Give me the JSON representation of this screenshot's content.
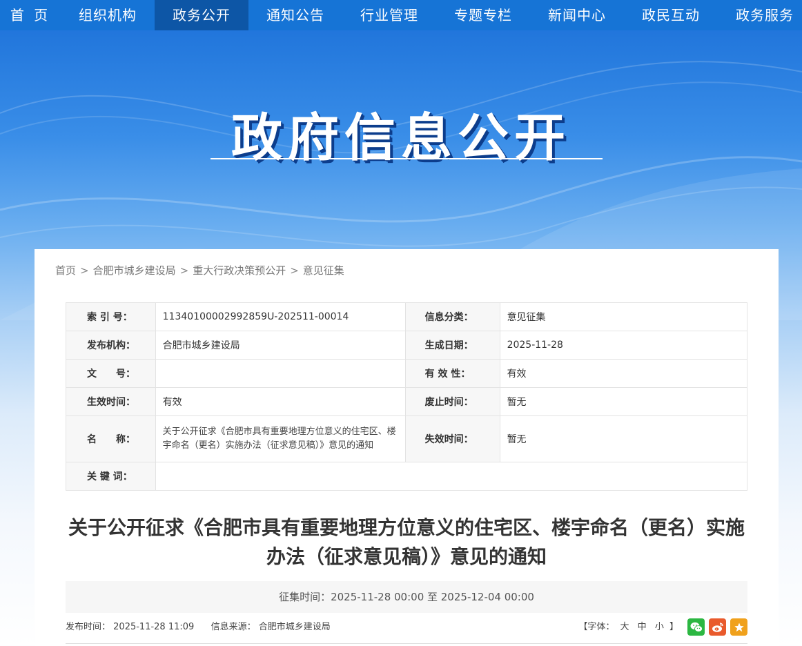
{
  "nav": {
    "items": [
      {
        "label": "首 页"
      },
      {
        "label": "组织机构"
      },
      {
        "label": "政务公开"
      },
      {
        "label": "通知公告"
      },
      {
        "label": "行业管理"
      },
      {
        "label": "专题专栏"
      },
      {
        "label": "新闻中心"
      },
      {
        "label": "政民互动"
      },
      {
        "label": "政务服务"
      }
    ],
    "active_index": 2,
    "color": "#1674d6",
    "active_color": "#0d56a6"
  },
  "banner": {
    "title": "政府信息公开"
  },
  "breadcrumb": {
    "items": [
      "首页",
      "合肥市城乡建设局",
      "重大行政决策预公开",
      "意见征集"
    ],
    "separator": ">"
  },
  "meta": {
    "index_no_label": "索 引 号：",
    "index_no": "11340100002992859U-202511-00014",
    "category_label": "信息分类：",
    "category": "意见征集",
    "publisher_label": "发布机构：",
    "publisher": "合肥市城乡建设局",
    "created_label": "生成日期：",
    "created": "2025-11-28",
    "doc_no_label": "文　　号：",
    "doc_no": "",
    "validity_label": "有 效 性：",
    "validity": "有效",
    "effective_label": "生效时间：",
    "effective": "有效",
    "repeal_label": "废止时间：",
    "repeal": "暂无",
    "name_label": "名　　称：",
    "name": "关于公开征求《合肥市具有重要地理方位意义的住宅区、楼宇命名（更名）实施办法（征求意见稿）》意见的通知",
    "expire_label": "失效时间：",
    "expire": "暂无",
    "keywords_label": "关 键 词：",
    "keywords": ""
  },
  "article": {
    "title": "关于公开征求《合肥市具有重要地理方位意义的住宅区、楼宇命名（更名）实施办法（征求意见稿）》意见的通知",
    "collect_period": "征集时间：2025-11-28 00:00 至 2025-12-04 00:00",
    "publish_time_label": "发布时间：",
    "publish_time": "2025-11-28 11:09",
    "source_label": "信息来源：",
    "source": "合肥市城乡建设局",
    "font_size_label": "【字体：",
    "font_large": "大",
    "font_medium": "中",
    "font_small": "小",
    "font_size_end": "】"
  },
  "share": {
    "wechat_icon": "wechat-icon",
    "weibo_icon": "weibo-icon",
    "favorite_icon": "star-icon"
  }
}
